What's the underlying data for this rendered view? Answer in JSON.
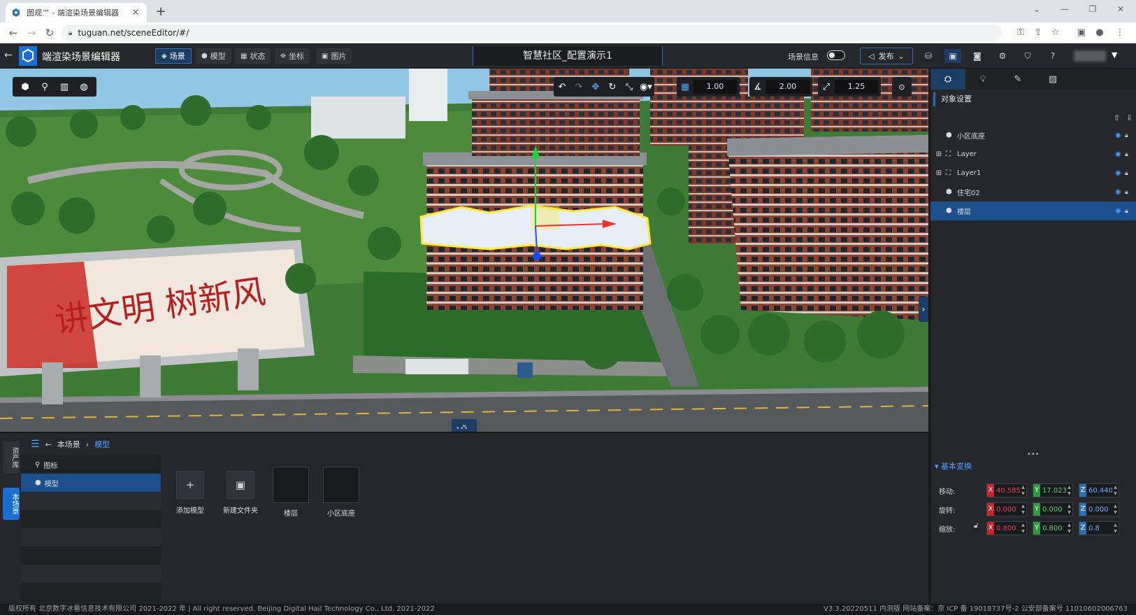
{
  "browser": {
    "tab_title": "图观™ - 端渲染场景编辑器",
    "url": "tuguan.net/sceneEditor/#/"
  },
  "header": {
    "app_title": "端渲染场景编辑器",
    "nav": [
      {
        "label": "场景",
        "icon": "scene-icon",
        "active": true
      },
      {
        "label": "模型",
        "icon": "model-icon",
        "active": false
      },
      {
        "label": "状态",
        "icon": "state-icon",
        "active": false
      },
      {
        "label": "坐标",
        "icon": "coordinate-icon",
        "active": false
      },
      {
        "label": "图片",
        "icon": "image-icon",
        "active": false
      }
    ],
    "scene_title": "智慧社区_配置演示1",
    "scene_info_label": "场景信息",
    "publish_label": "发布"
  },
  "viewport": {
    "tools": [
      "cube-icon",
      "pin-icon",
      "building-icon",
      "globe-icon"
    ],
    "snap_move": "1.00",
    "snap_rotate": "2.00",
    "snap_scale": "1.25"
  },
  "right_panel": {
    "section_title": "对象设置",
    "tree": [
      {
        "label": "小区底座",
        "icon": "cube-icon",
        "expandable": false,
        "selected": false
      },
      {
        "label": "Layer",
        "icon": "layer-icon",
        "expandable": true,
        "selected": false
      },
      {
        "label": "Layer1",
        "icon": "layer-icon",
        "expandable": true,
        "selected": false
      },
      {
        "label": "住宅02",
        "icon": "cube-icon",
        "expandable": false,
        "selected": false
      },
      {
        "label": "楼层",
        "icon": "cube-icon",
        "expandable": false,
        "selected": true
      }
    ],
    "transform": {
      "title": "基本变换",
      "move_label": "移动:",
      "rotate_label": "旋转:",
      "scale_label": "缩放:",
      "move": {
        "x": "40.585",
        "y": "17.023",
        "z": "60.440"
      },
      "rotate": {
        "x": "0.000",
        "y": "0.000",
        "z": "0.000"
      },
      "scale": {
        "x": "0.800",
        "y": "0.800",
        "z": "0.8"
      }
    }
  },
  "bottom_panel": {
    "side_tabs": [
      "资产库",
      "本场景"
    ],
    "breadcrumb_root": "本场景",
    "breadcrumb_current": "模型",
    "tree": [
      "图标",
      "模型"
    ],
    "assets": [
      {
        "label": "添加模型",
        "type": "add"
      },
      {
        "label": "新建文件夹",
        "type": "folder"
      },
      {
        "label": "楼层",
        "type": "thumb"
      },
      {
        "label": "小区底座",
        "type": "thumb"
      }
    ]
  },
  "footer": {
    "left": "版权所有 北京数字冰雹信息技术有限公司 2021-2022 年 | All right reserved. Beijing Digital Hail Technology Co., Ltd. 2021-2022",
    "right": "V3.3.20220511 内测版 网站备案：京 ICP 备 19018737号-2 公安部备案号 11010602006763"
  },
  "colors": {
    "accent": "#2e6fb3",
    "selected_row": "#1c4f8b",
    "axis_x": "#c9242b",
    "axis_y": "#2f9a3d",
    "axis_z": "#2e6fb3"
  }
}
